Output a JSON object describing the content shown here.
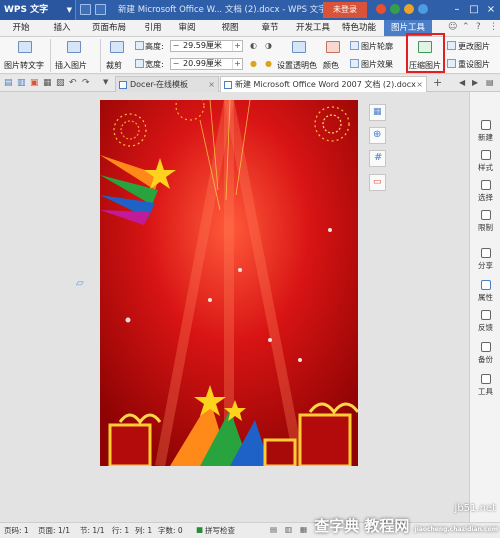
{
  "title_bar": {
    "app_name": "WPS 文字",
    "document_title": "新建 Microsoft Office W... 文档 (2).docx - WPS 文字",
    "login_label": "未登录"
  },
  "menu": {
    "tabs": [
      "开始",
      "插入",
      "页面布局",
      "引用",
      "审阅",
      "视图",
      "章节",
      "开发工具",
      "特色功能",
      "图片工具"
    ],
    "active_tab": "图片工具"
  },
  "ribbon": {
    "pic_to_text": "图片转文字",
    "insert_pic": "插入图片",
    "crop": "裁剪",
    "height_label": "高度:",
    "height_value": "29.59厘米",
    "width_label": "宽度:",
    "width_value": "20.99厘米",
    "set_transparent": "设置透明色",
    "color": "颜色",
    "pic_outline": "图片轮廓",
    "pic_effect": "图片效果",
    "compress": "压缩图片",
    "change_pic": "更改图片",
    "reset_pic": "重设图片"
  },
  "doc_tabs": {
    "tab1": "Docer-在线模板",
    "tab2": "新建 Microsoft Office Word 2007 文档 (2).docx",
    "add": "+"
  },
  "right_panel": {
    "items": [
      "新建",
      "样式",
      "选择",
      "限制",
      "分享",
      "属性",
      "反馈",
      "备份",
      "工具"
    ]
  },
  "status_bar": {
    "page_num": "页码: 1",
    "pages": "页面: 1/1",
    "section": "节: 1/1",
    "row": "行: 1",
    "col": "列: 1",
    "word_count": "字数: 0",
    "spell_check": "拼写检查"
  },
  "watermark": {
    "url": "jb51.net",
    "text": "查字典 教程网",
    "url2": "jiaocheng.chazidian.com"
  },
  "colors": {
    "title_blue": "#2f5fa8",
    "active_tab_blue": "#4a7fc8",
    "highlight_red": "#e02020",
    "login_red": "#d9533b",
    "poster_red": "#c91010"
  },
  "icons": {
    "compress": "compress-picture-icon",
    "crop": "crop-icon",
    "zoom": "zoom-icon"
  }
}
